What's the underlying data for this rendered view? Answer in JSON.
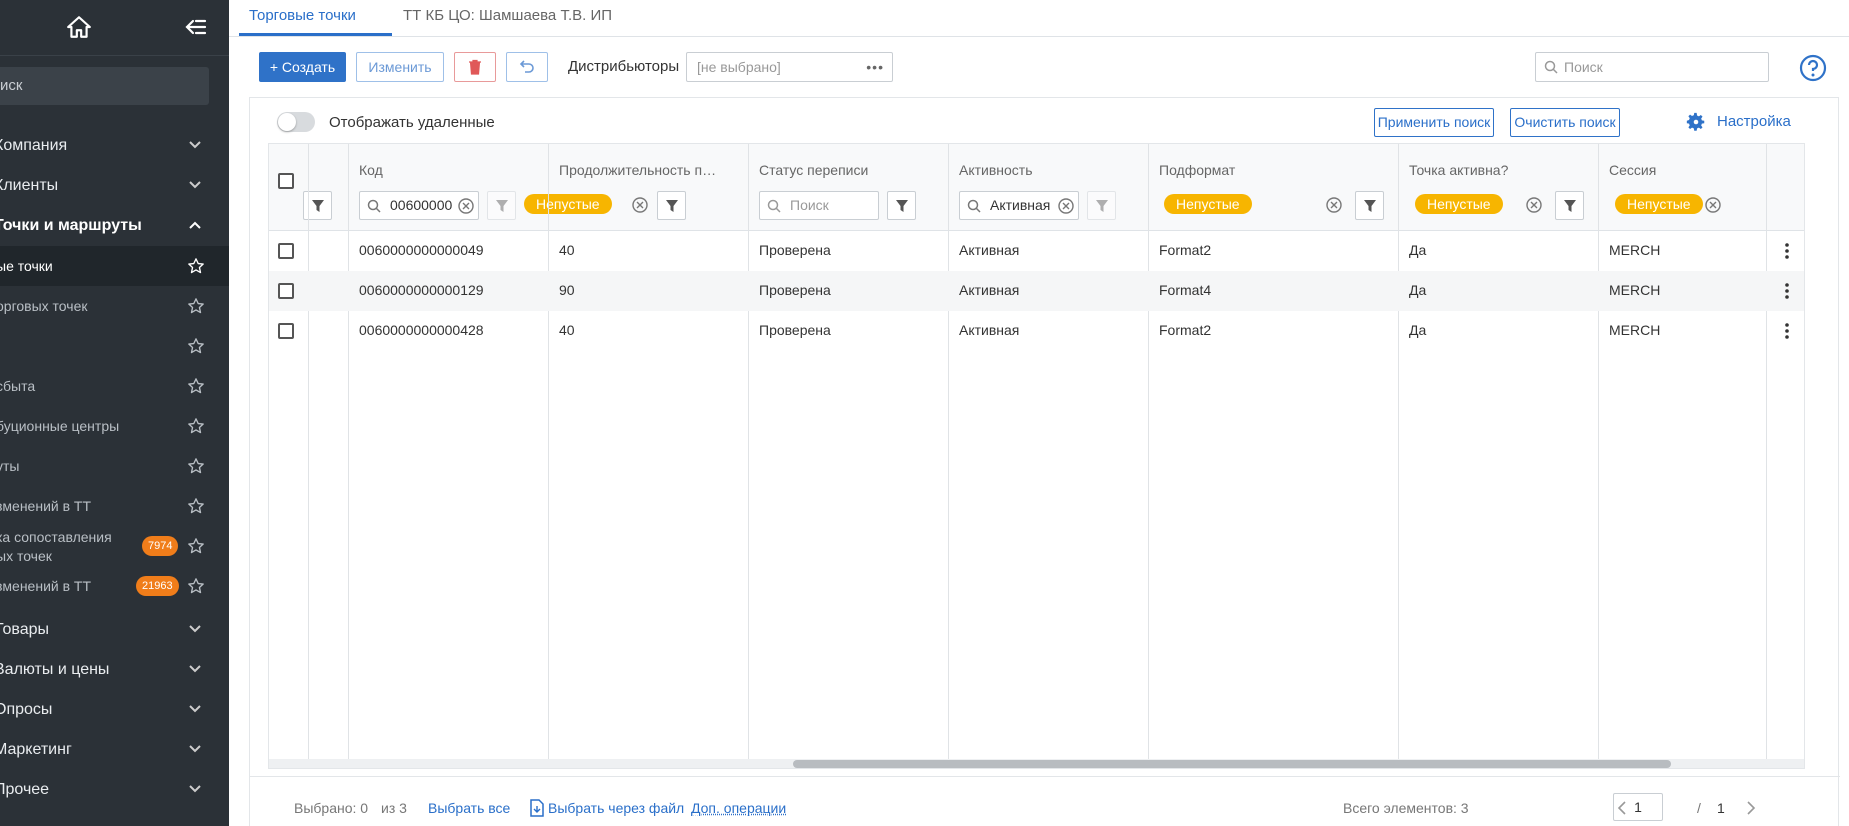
{
  "sidebar": {
    "search_label": "иск",
    "groups": [
      {
        "label": "Компания"
      },
      {
        "label": "Клиенты"
      },
      {
        "label": "Точки и маршруты"
      }
    ],
    "subitems": [
      {
        "label": "ые точки"
      },
      {
        "label": "орговых точек"
      },
      {
        "label": ""
      },
      {
        "label": "сбыта"
      },
      {
        "label": "буционные центры"
      },
      {
        "label": "уты"
      },
      {
        "label": "зменений в ТТ"
      },
      {
        "label_line1": "ка сопоставления",
        "label_line2": "ых точек",
        "badge": "7974"
      },
      {
        "label": "зменений в ТТ",
        "badge": "21963"
      }
    ],
    "bottom_groups": [
      {
        "label": "Товары"
      },
      {
        "label": "Валюты и цены"
      },
      {
        "label": "Опросы"
      },
      {
        "label": "Маркетинг"
      },
      {
        "label": "Прочее"
      }
    ]
  },
  "tabs": [
    {
      "label": "Торговые точки"
    },
    {
      "label": "ТТ КБ ЦО: Шамшаева Т.В. ИП"
    }
  ],
  "toolbar": {
    "create_label": "+ Создать",
    "edit_label": "Изменить",
    "distributors_label": "Дистрибьюторы",
    "distributors_value": "[не выбрано]",
    "search_placeholder": "Поиск"
  },
  "panel": {
    "show_deleted_label": "Отображать удаленные",
    "apply_search_label": "Применить поиск",
    "clear_search_label": "Очистить поиск",
    "settings_label": "Настройка"
  },
  "grid": {
    "columns": [
      {
        "title": "Код",
        "filter_value": "00600000"
      },
      {
        "title": "Продолжительность пос...",
        "chip": "Непустые"
      },
      {
        "title": "Статус переписи",
        "filter_placeholder": "Поиск"
      },
      {
        "title": "Активность",
        "filter_value": "Активная"
      },
      {
        "title": "Подформат",
        "chip": "Непустые"
      },
      {
        "title": "Точка активна?",
        "chip": "Непустые"
      },
      {
        "title": "Сессия",
        "chip": "Непустые"
      }
    ],
    "rows": [
      {
        "code": "0060000000000049",
        "duration": "40",
        "census": "Проверена",
        "activity": "Активная",
        "subformat": "Format2",
        "active": "Да",
        "session": "MERCH"
      },
      {
        "code": "0060000000000129",
        "duration": "90",
        "census": "Проверена",
        "activity": "Активная",
        "subformat": "Format4",
        "active": "Да",
        "session": "MERCH"
      },
      {
        "code": "0060000000000428",
        "duration": "40",
        "census": "Проверена",
        "activity": "Активная",
        "subformat": "Format2",
        "active": "Да",
        "session": "MERCH"
      }
    ]
  },
  "footer": {
    "selected_label": "Выбрано: 0",
    "of_label": "из 3",
    "select_all_label": "Выбрать все",
    "select_file_label": "Выбрать через файл",
    "extra_ops_label": "Доп. операции",
    "total_label": "Всего элементов: 3",
    "page_value": "1",
    "page_sep": "/",
    "page_total": "1"
  },
  "colors": {
    "sidebar_bg": "#2b3137",
    "accent": "#2f72c8",
    "chip": "#f7b500",
    "badge": "#f07d1a"
  }
}
